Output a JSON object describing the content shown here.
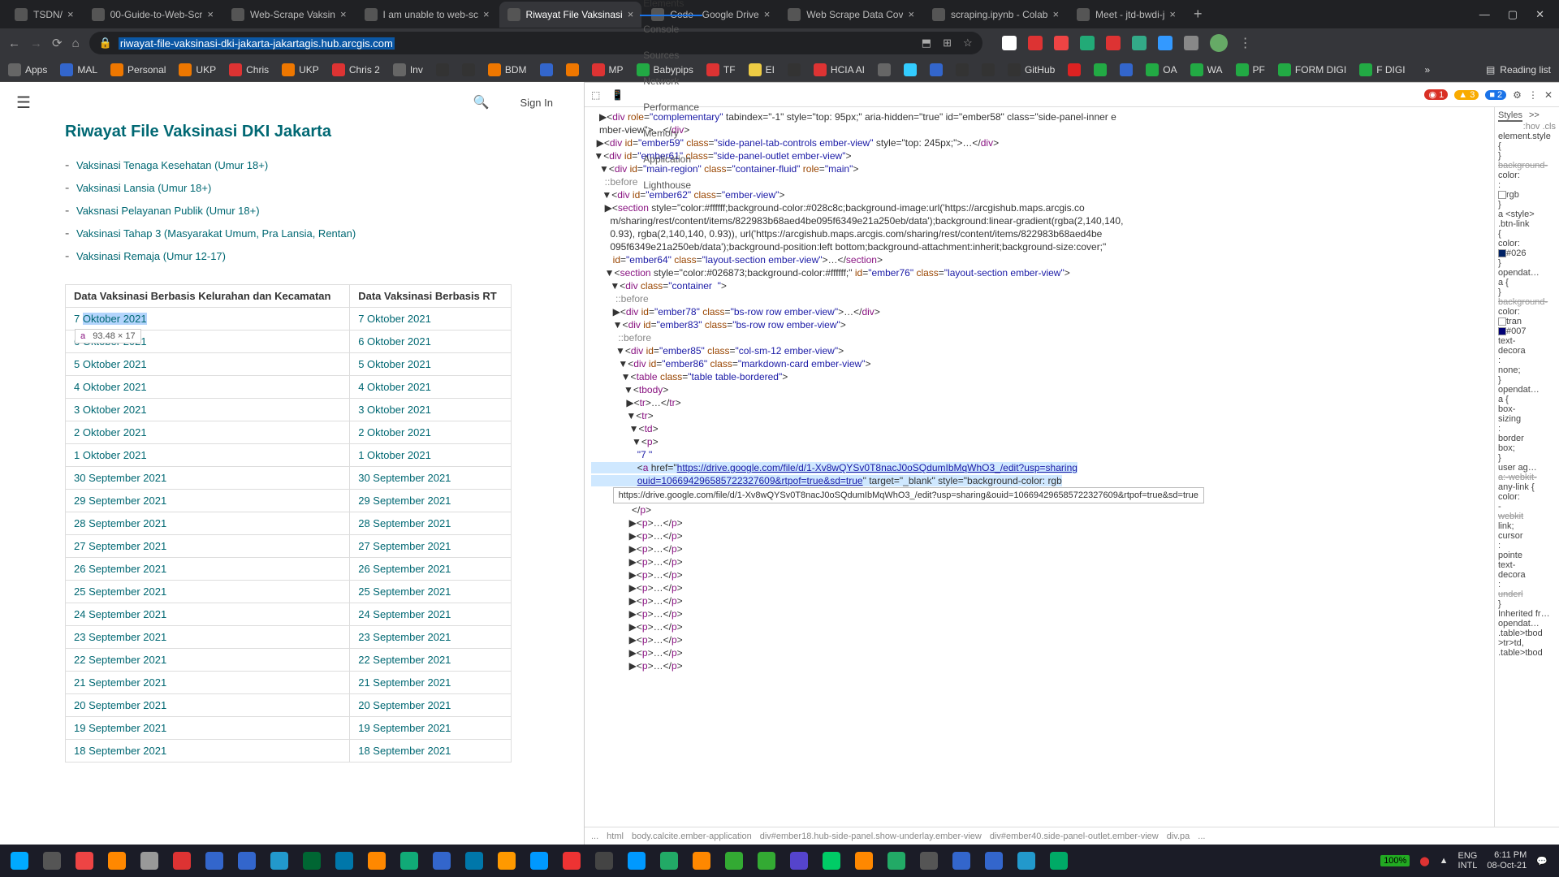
{
  "browser": {
    "tabs": [
      {
        "title": "TSDN/",
        "active": false
      },
      {
        "title": "00-Guide-to-Web-Scr",
        "active": false
      },
      {
        "title": "Web-Scrape Vaksin",
        "active": false
      },
      {
        "title": "I am unable to web-sc",
        "active": false
      },
      {
        "title": "Riwayat File Vaksinasi",
        "active": true
      },
      {
        "title": "Code - Google Drive",
        "active": false
      },
      {
        "title": "Web Scrape Data Cov",
        "active": false
      },
      {
        "title": "scraping.ipynb - Colab",
        "active": false
      },
      {
        "title": "Meet - jtd-bwdi-j",
        "active": false
      }
    ],
    "url": "riwayat-file-vaksinasi-dki-jakarta-jakartagis.hub.arcgis.com",
    "bookmarks": [
      "Apps",
      "MAL",
      "Personal",
      "UKP",
      "Chris",
      "UKP",
      "Chris 2",
      "Inv",
      "",
      "",
      "BDM",
      "",
      "",
      "MP",
      "Babypips",
      "TF",
      "EI",
      "",
      "HCIA AI",
      "",
      "",
      "",
      "",
      "",
      "GitHub",
      "",
      "",
      "",
      "OA",
      "WA",
      "PF",
      "FORM DIGI",
      "F DIGI"
    ],
    "reading_list": "Reading list"
  },
  "page": {
    "sign_in": "Sign In",
    "title": "Riwayat File Vaksinasi DKI Jakarta",
    "links": [
      "Vaksinasi Tenaga Kesehatan (Umur 18+)",
      "Vaksinasi Lansia (Umur 18+)",
      "Vaksnasi Pelayanan Publik (Umur 18+)",
      "Vaksinasi Tahap 3 (Masyarakat Umum, Pra Lansia, Rentan)",
      "Vaksinasi Remaja (Umur 12-17)"
    ],
    "hover_tip": "a   93.48 × 17",
    "table": {
      "headers": [
        "Data Vaksinasi Berbasis Kelurahan dan Kecamatan",
        "Data Vaksinasi Berbasis RT"
      ],
      "rows": [
        [
          "7 Oktober 2021",
          "7 Oktober 2021"
        ],
        [
          "6 Oktober 2021",
          "6 Oktober 2021"
        ],
        [
          "5 Oktober 2021",
          "5 Oktober 2021"
        ],
        [
          "4 Oktober 2021",
          "4 Oktober 2021"
        ],
        [
          "3 Oktober 2021",
          "3 Oktober 2021"
        ],
        [
          "2 Oktober 2021",
          "2 Oktober 2021"
        ],
        [
          "1 Oktober 2021",
          "1 Oktober 2021"
        ],
        [
          "30 September 2021",
          "30 September 2021"
        ],
        [
          "29 September 2021",
          "29 September 2021"
        ],
        [
          "28 September 2021",
          "28 September 2021"
        ],
        [
          "27 September 2021",
          "27 September 2021"
        ],
        [
          "26 September 2021",
          "26 September 2021"
        ],
        [
          "25 September 2021",
          "25 September 2021"
        ],
        [
          "24 September 2021",
          "24 September 2021"
        ],
        [
          "23 September 2021",
          "23 September 2021"
        ],
        [
          "22 September 2021",
          "22 September 2021"
        ],
        [
          "21 September 2021",
          "21 September 2021"
        ],
        [
          "20 September 2021",
          "20 September 2021"
        ],
        [
          "19 September 2021",
          "19 September 2021"
        ],
        [
          "18 September 2021",
          "18 September 2021"
        ]
      ]
    }
  },
  "devtools": {
    "tabs": [
      "Elements",
      "Console",
      "Sources",
      "Network",
      "Performance",
      "Memory",
      "Application",
      "Lighthouse"
    ],
    "active_tab": "Elements",
    "err_count": "1",
    "warn_count": "3",
    "info_count": "2",
    "styles_tabs": [
      "Styles",
      ">>"
    ],
    "hov_cls": ":hov  .cls",
    "hover_url": "https://drive.google.com/file/d/1-Xv8wQYSv0T8nacJ0oSQdumIbMqWhO3_/edit?usp=sharing&ouid=106694296585722327609&rtpof=true&sd=true",
    "drive_link": "https://drive.google.com/file/d/1-Xv8wQYSv0T8nacJ0oSQdumIbMqWhO3_/edit?usp=sharing&ouid=106694296585722327609&rtpof=true&sd=true",
    "crumbs": [
      "...",
      "html",
      "body.calcite.ember-application",
      "div#ember18.hub-side-panel.show-underlay.ember-view",
      "div#ember40.side-panel-outlet.ember-view",
      "div.pa",
      "..."
    ],
    "styles_rules": [
      "element.style {",
      "}",
      "background-",
      "  color:",
      "   :",
      "   □rgb",
      "}",
      "a    <style>",
      ".btn-link",
      "{",
      "  color:",
      "   ■#026",
      "}",
      "opendat…",
      "a {",
      "}",
      "background-",
      "  color:",
      "   □tran",
      "   ■#007",
      "text-",
      "  decora",
      "  :",
      "  none;",
      "}",
      "opendat…",
      "a {",
      "  box-",
      "   sizing",
      "   :",
      "   border",
      "   box;",
      "}",
      "user ag…",
      "a:-webkit-",
      "any-link {",
      "  color:",
      "   -",
      "   webkit",
      "   link;",
      "  cursor",
      "   :",
      "   pointe",
      "  text-",
      "   decora",
      "   :",
      "   underl",
      "}",
      "Inherited fr…",
      "opendat…",
      ".table>tbod",
      ">tr>td,",
      ".table>tbod"
    ]
  },
  "taskbar": {
    "battery": "100%",
    "lang": "ENG",
    "intl": "INTL",
    "time": "6:11 PM",
    "date": "08-Oct-21"
  }
}
